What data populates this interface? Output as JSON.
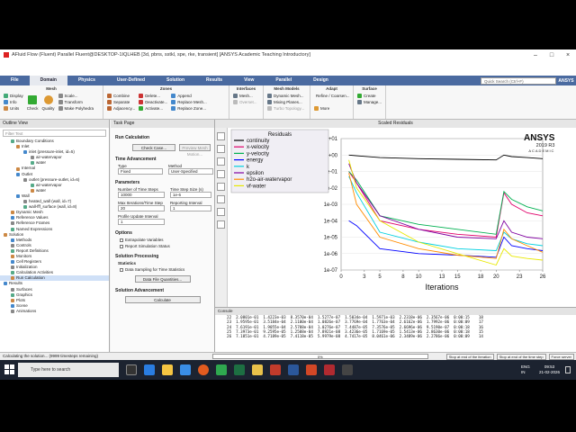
{
  "window": {
    "title": "AFluid Flow (Fluent) Parallel Fluent@DESKTOP-1IQLHEB [3d, pbns, sstkl, spe, rke, transient] [ANSYS Academic Teaching Introductory]"
  },
  "tabs": [
    "File",
    "Domain",
    "Physics",
    "User-Defined",
    "Solution",
    "Results",
    "View",
    "Parallel",
    "Design"
  ],
  "active_tab": "Domain",
  "search_placeholder": "Quick Search (Ctrl+F)",
  "ansys_small": "ANSYS",
  "ribbon": {
    "mesh_group": "Mesh",
    "mesh_items": [
      "Display",
      "Info",
      "Units",
      "Check",
      "Quality",
      "Scale...",
      "Transform",
      "Make Polyhedra"
    ],
    "zones_group": "Zones",
    "zones_items": [
      "Combine",
      "Separate",
      "Adjacency...",
      "Delete...",
      "Deactivate...",
      "Activate...",
      "Append",
      "Replace Mesh...",
      "Replace Zone..."
    ],
    "interfaces_group": "Interfaces",
    "interfaces_items": [
      "Mesh...",
      "Overset..."
    ],
    "mesh_models_group": "Mesh Models",
    "mesh_models_items": [
      "Dynamic Mesh...",
      "Mixing Planes...",
      "Turbo Topology..."
    ],
    "adapt_group": "Adapt",
    "adapt_items": [
      "Refine / Coarsen...",
      "More"
    ],
    "surface_group": "Surface",
    "surface_items": [
      "Create",
      "Manage..."
    ]
  },
  "outline": {
    "header": "Outline View",
    "filter_placeholder": "Filter Text",
    "tree": [
      "Boundary Conditions",
      "Inlet",
      "inlet (pressure-inlet, id=5)",
      "air-watervapor",
      "water",
      "Internal",
      "Outlet",
      "outlet (pressure-outlet, id=6)",
      "air-watervapor",
      "water",
      "Wall",
      "heated_wall (wall, id=7)",
      "wall-fff_surface (wall, id=8)",
      "Dynamic Mesh",
      "Reference Values",
      "Reference Frames",
      "Named Expressions",
      "Solution",
      "Methods",
      "Controls",
      "Report Definitions",
      "Monitors",
      "Cell Registers",
      "Initialization",
      "Calculation Activities",
      "Run Calculation",
      "Results",
      "Surfaces",
      "Graphics",
      "Plots",
      "Scene",
      "Animations"
    ]
  },
  "task": {
    "header": "Task Page",
    "title": "Run Calculation",
    "check_case": "Check Case...",
    "preview_mesh": "Preview Mesh Motion...",
    "time_adv_title": "Time Advancement",
    "type_label": "Type",
    "type_value": "Fixed",
    "method_label": "Method",
    "method_value": "User-Specified",
    "params_title": "Parameters",
    "nsteps_label": "Number of Time Steps",
    "nsteps_value": "10000",
    "stepsize_label": "Time Step Size (s)",
    "stepsize_value": "1e-6",
    "maxiter_label": "Max Iterations/Time Step",
    "maxiter_value": "20",
    "reporting_label": "Reporting Interval",
    "reporting_value": "1",
    "profile_label": "Profile Update Interval",
    "profile_value": "1",
    "options_title": "Options",
    "opt1": "Extrapolate Variables",
    "opt2": "Report Simulation Status",
    "solproc_title": "Solution Processing",
    "stats_title": "Statistics",
    "opt3": "Data Sampling for Time Statistics",
    "data_quant": "Data File Quantities...",
    "advancement_title": "Solution Advancement",
    "calculate": "Calculate"
  },
  "graphics_title": "Scaled Residuals",
  "chart_data": {
    "type": "line",
    "title": "",
    "xlabel": "Iterations",
    "ylabel": "",
    "xlim": [
      0,
      26
    ],
    "ylim_log10": [
      -7,
      1
    ],
    "xticks": [
      "0",
      "3",
      "5",
      "8",
      "10",
      "13",
      "15",
      "18",
      "20",
      "23",
      "26"
    ],
    "yticks": [
      "1e+01",
      "1e+00",
      "1e-01",
      "1e-02",
      "1e-03",
      "1e-04",
      "1e-05",
      "1e-06",
      "1e-07"
    ],
    "legend_title": "Residuals",
    "series": [
      {
        "name": "continuity",
        "color": "#000000",
        "x": [
          1,
          2,
          5,
          10,
          15,
          20,
          21,
          22,
          24,
          26
        ],
        "y": [
          1,
          0.9,
          0.7,
          0.6,
          0.55,
          0.5,
          1,
          0.8,
          0.7,
          0.6
        ]
      },
      {
        "name": "x-velocity",
        "color": "#e0006a",
        "x": [
          1,
          2,
          5,
          10,
          15,
          20,
          21,
          22,
          24,
          26
        ],
        "y": [
          0.1,
          0.02,
          0.0001,
          3e-05,
          1.5e-05,
          1e-05,
          0.005,
          0.001,
          0.0003,
          0.0002
        ]
      },
      {
        "name": "y-velocity",
        "color": "#00b050",
        "x": [
          1,
          2,
          5,
          10,
          15,
          20,
          21,
          22,
          24,
          26
        ],
        "y": [
          0.1,
          0.03,
          0.0002,
          6e-05,
          3e-05,
          1.5e-05,
          0.006,
          0.002,
          0.0007,
          0.0004
        ]
      },
      {
        "name": "energy",
        "color": "#0000ff",
        "x": [
          1,
          2,
          5,
          10,
          15,
          20,
          21,
          22,
          24,
          26
        ],
        "y": [
          0.0001,
          5e-05,
          2e-06,
          1e-06,
          8e-07,
          6e-07,
          1e-05,
          3e-06,
          2e-06,
          1.5e-06
        ]
      },
      {
        "name": "k",
        "color": "#00d0e0",
        "x": [
          1,
          2,
          5,
          10,
          15,
          20,
          21,
          22,
          24,
          26
        ],
        "y": [
          0.05,
          0.005,
          2e-05,
          5e-06,
          2e-06,
          1.5e-06,
          2e-05,
          8e-06,
          4e-06,
          3e-06
        ]
      },
      {
        "name": "epsilon",
        "color": "#8000a0",
        "x": [
          1,
          2,
          5,
          10,
          15,
          20,
          21,
          22,
          24,
          26
        ],
        "y": [
          0.3,
          0.02,
          0.0002,
          3e-05,
          1e-05,
          8e-06,
          0.0001,
          2e-05,
          1e-05,
          8e-06
        ]
      },
      {
        "name": "h2o-air-watervapor",
        "color": "#ff8c00",
        "x": [
          1,
          2,
          5,
          10,
          15,
          20,
          21,
          22,
          24,
          26
        ],
        "y": [
          0.08,
          0.001,
          1e-05,
          2e-06,
          8e-07,
          5e-07,
          3e-05,
          8e-06,
          3e-06,
          1.2e-06
        ]
      },
      {
        "name": "vf-water",
        "color": "#e8e800",
        "x": [
          1,
          2,
          5,
          10,
          15,
          20,
          21,
          22,
          24,
          26
        ],
        "y": [
          0.5,
          0.01,
          0.0001,
          5e-06,
          1e-06,
          2e-07,
          2e-06,
          7e-07,
          5e-07,
          4e-07
        ]
      }
    ]
  },
  "branding": {
    "name": "ANSYS",
    "version": "2019 R3",
    "edition": "ACADEMIC"
  },
  "console": {
    "header": "Console",
    "lines": [
      "  22  2.0801e-01  1.4223e-03  8.3570e-04  1.5277e-07  1.5034e-04  1.5971e-03  2.2318e-06  2.3567e-06  0:00:15    18",
      "  23  1.9595e-01  3.5184e-04  2.1100e-04  1.0826e-07  3.7769e-04  1.7763e-04  2.6162e-06  1.7992e-06  0:00:09    17",
      "  24  7.6191e-01  1.9055e-04  2.5788e-04  1.0276e-07  7.4487e-05  7.3576e-05  2.6696e-06  9.5190e-07  0:00:18    16",
      "  25  7.3973e-01  9.2595e-05  1.2588e-04  7.8921e-08  3.4236e-05  1.7169e-05  1.5413e-06  2.8630e-06  0:00:18    15",
      "  26  7.1851e-01  4.7189e-05  7.4118e-05  5.9979e-08  4.7417e-05  8.0461e-06  2.3489e-06  2.2786e-06  0:00:09    14"
    ]
  },
  "status": {
    "text": "Calculating the solution... (9999 timesteps remaining)",
    "progress": "0%",
    "stop_iter": "Stop at end of the iteration",
    "stop_step": "Stop at end of the time step",
    "force": "Force server"
  },
  "taskbar": {
    "search": "Type here to search",
    "lang": "ENG IN",
    "time": "09:53",
    "date": "21-02-2026"
  }
}
